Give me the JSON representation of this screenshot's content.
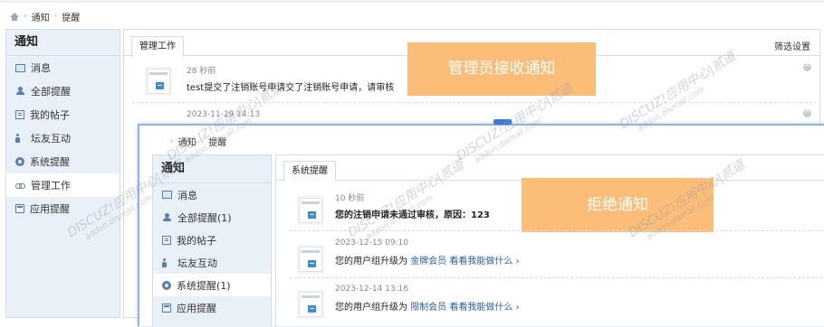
{
  "colors": {
    "banner": "#fbbd78",
    "sidebar_bg": "#eaf0f7",
    "link": "#2a5d9c",
    "accent_blue": "#3a7bd5"
  },
  "breadcrumb": {
    "home_icon": "home-icon",
    "items": [
      "通知",
      "提醒"
    ]
  },
  "sidebar": {
    "title": "通知",
    "items": [
      {
        "icon": "mail-icon",
        "label": "消息"
      },
      {
        "icon": "person-icon",
        "label": "全部提醒"
      },
      {
        "icon": "posts-icon",
        "label": "我的帖子"
      },
      {
        "icon": "friends-icon",
        "label": "坛友互动"
      },
      {
        "icon": "gear-icon",
        "label": "系统提醒"
      },
      {
        "icon": "link-icon",
        "label": "管理工作"
      },
      {
        "icon": "app-icon",
        "label": "应用提醒"
      }
    ]
  },
  "main": {
    "tab": "管理工作",
    "filter": "筛选设置",
    "banner": "管理员接收通知",
    "notices": [
      {
        "time": "28 秒前",
        "message": "test提交了注销账号申请交了注销账号申请，请审核"
      },
      {
        "time": "2023-11-29 14:13"
      }
    ]
  },
  "overlay": {
    "breadcrumb": [
      "通知",
      "提醒"
    ],
    "sidebar": {
      "title": "通知",
      "items": [
        {
          "icon": "mail-icon",
          "label": "消息"
        },
        {
          "icon": "person-icon",
          "label": "全部提醒(1)"
        },
        {
          "icon": "posts-icon",
          "label": "我的帖子"
        },
        {
          "icon": "friends-icon",
          "label": "坛友互动"
        },
        {
          "icon": "gear-icon",
          "label": "系统提醒(1)"
        },
        {
          "icon": "app-icon",
          "label": "应用提醒"
        }
      ]
    },
    "tab": "系统提醒",
    "banner": "拒绝通知",
    "notices": [
      {
        "time": "10 秒前",
        "message": "您的注销申请未通过审核，原因：123"
      },
      {
        "time": "2023-12-15 09:10",
        "prefix": "您的用户组升级为",
        "group": "金牌会员",
        "link": "看看我能做什么 ›"
      },
      {
        "time": "2023-12-14 13:16",
        "prefix": "您的用户组升级为",
        "group": "限制会员",
        "link": "看看我能做什么 ›"
      }
    ]
  },
  "watermarks": [
    {
      "text": "DISCUZ!应用中心|贰道",
      "sub": "addon.dismall.com"
    }
  ]
}
